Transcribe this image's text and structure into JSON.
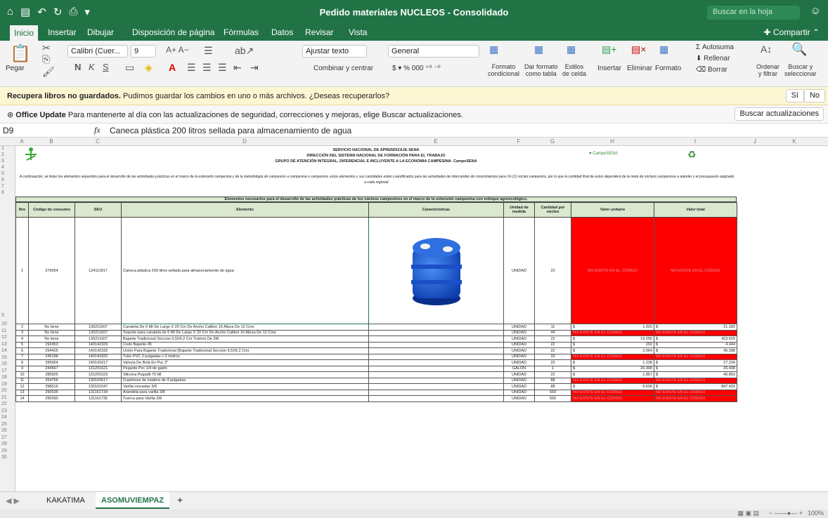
{
  "titlebar": {
    "title": "Pedido materiales NUCLEOS - Consolidado",
    "search_placeholder": "Buscar en la hoja"
  },
  "tabs": [
    "Inicio",
    "Insertar",
    "Dibujar",
    "Disposición de página",
    "Fórmulas",
    "Datos",
    "Revisar",
    "Vista"
  ],
  "share": "Compartir",
  "ribbon": {
    "paste": "Pegar",
    "font_name": "Calibri (Cuer...",
    "font_size": "9",
    "wrap_text": "Ajustar texto",
    "merge_center": "Combinar y centrar",
    "number_format": "General",
    "conditional_format": "Formato\ncondicional",
    "format_table": "Dar formato\ncomo tabla",
    "cell_styles": "Estilos\nde celda",
    "insert": "Insertar",
    "delete": "Eliminar",
    "format": "Formato",
    "autosum": "Autosuma",
    "fill": "Rellenar",
    "clear": "Borrar",
    "sort_filter": "Ordenar\ny filtrar",
    "find_select": "Buscar y\nseleccionar"
  },
  "message_bar": {
    "bold": "Recupera libros no guardados.",
    "text": "Pudimos guardar los cambios en uno o más archivos. ¿Deseas recuperarlos?",
    "yes": "Sí",
    "no": "No"
  },
  "update_bar": {
    "bold": "Office Update",
    "text": "Para mantenerte al día con las actualizaciones de seguridad, correcciones y mejoras, elige Buscar actualizaciones.",
    "button": "Buscar actualizaciones"
  },
  "formula_bar": {
    "name_box": "D9",
    "fx": "fx",
    "value": "Caneca plástica 200 litros sellada para almacenamiento de agua"
  },
  "columns": [
    "A",
    "B",
    "C",
    "D",
    "E",
    "F",
    "G",
    "H",
    "I",
    "J",
    "K"
  ],
  "sheet": {
    "header_lines": [
      "SERVICIO NACIONAL DE APRENDIZAJE-SENA",
      "DIRECCIÓN DEL SISTEMA NACIONAL DE FORMACIÓN PARA EL TRABAJO",
      "GRUPO DE ATENCIÓN INTEGRAL, DIFERENCIAL E INCLUYENTE A LA ECONOMIA CAMPESINA- CampeSENA"
    ],
    "logo_right_text": "CampeSENA",
    "intro": "A continuación, se listan los elementos requeridos para el desarrollo de las actividades prácticas en el marco de la extensión campesina y de la metodología de campesino a campesina o campesino, estos elementos y sus cantidades están cuantificados para las actividades de intercambio de conocimientos para Un (1) núcleo campesino, por lo que la cantidad final de estos dependerá de la meta de núcleos campesinos a atender y el presupuesto asignado a cada regional.",
    "section_title": "Elementos necesarios para el desarrollo de las actividades prácticas de los núcleos campesinos en el marco de la extensión campesina con enfoque agroecológico.",
    "headers": [
      "Nro",
      "Código de consumo",
      "SKU",
      "Elemento",
      "Características",
      "Unidad de medida",
      "Cantidad por núcleo",
      "Valor unitario",
      "Valor total"
    ],
    "no_code_text": "NO EXISTE EN EL CÓDIGO",
    "rows": [
      {
        "n": "1",
        "code": "279054",
        "sku": "124111817",
        "item": "Caneca plástica 200 litros sellada para almacenamiento de agua",
        "unit": "UNIDAD",
        "qty": "22",
        "vu": "",
        "vt": ""
      },
      {
        "n": "2",
        "code": "No tiene",
        "sku": "130211607",
        "item": "Canaleta De 6 Mt De Largo X 20 Cm De Ancho Calibre 16 Altura De 12 Cms",
        "unit": "UNIDAD",
        "qty": "11",
        "vu": "1.926",
        "vt": "21.182"
      },
      {
        "n": "3",
        "code": "No tiene",
        "sku": "130211607",
        "item": "Soporte para canaleta de 6 Mt De Largo X 20 Cm De Ancho Calibre 16 Altura De 12 Cms",
        "unit": "UNIDAD",
        "qty": "44",
        "vu": "",
        "vt": ""
      },
      {
        "n": "4",
        "code": "No tiene",
        "sku": "130211607",
        "item": "Bajante Tradicional Seccion 6,5X6,2 Cm Tramos De 3M",
        "unit": "UNIDAD",
        "qty": "22",
        "vu": "19.255",
        "vt": "423.629"
      },
      {
        "n": "5",
        "code": "292453",
        "sku": "140142329",
        "item": "Codo Bajante 45",
        "unit": "UNIDAD",
        "qty": "22",
        "vu": "202",
        "vt": "4.444"
      },
      {
        "n": "6",
        "code": "294425",
        "sku": "140142332",
        "item": "Unión Para Bajante Tradicional (Bajante Tradicional Seccion 6,5X6,2 Cm)",
        "unit": "UNIDAD",
        "qty": "22",
        "vu": "2.064",
        "vt": "45.398"
      },
      {
        "n": "7",
        "code": "249188",
        "sku": "140141825",
        "item": "Tubo PVC 2 pulgadas x 3 metros",
        "unit": "UNIDAD",
        "qty": "33",
        "vu": "",
        "vt": ""
      },
      {
        "n": "8",
        "code": "295654",
        "sku": "140141617",
        "item": "Valvula De Bola En Pvc 2\"",
        "unit": "UNIDAD",
        "qty": "22",
        "vu": "1.238",
        "vt": "27.234"
      },
      {
        "n": "9",
        "code": "244567",
        "sku": "131201621",
        "item": "Pegante Pvc 1/4 de galón",
        "unit": "GALON",
        "qty": "1",
        "vu": "26.408",
        "vt": "26.408"
      },
      {
        "n": "10",
        "code": "280925",
        "sku": "131201623",
        "item": "Silicona Pegadit 70 Ml",
        "unit": "UNIDAD",
        "qty": "22",
        "vu": "1.857",
        "vt": "40.863"
      },
      {
        "n": "11",
        "code": "254756",
        "sku": "130103617",
        "item": "Cuartones de madera de 4 pulgadas",
        "unit": "UNIDAD",
        "qty": "88",
        "vu": "",
        "vt": ""
      },
      {
        "n": "12",
        "code": "298516",
        "sku": "130101547",
        "item": "Varilla roscadas 3/8",
        "unit": "UNIDAD",
        "qty": "88",
        "vu": "9.630",
        "vt": "847.433"
      },
      {
        "n": "13",
        "code": "290535",
        "sku": "131161734",
        "item": "Arandela para varilla 3/8",
        "unit": "UNIDAD",
        "qty": "550",
        "vu": "",
        "vt": ""
      },
      {
        "n": "14",
        "code": "295390",
        "sku": "131161735",
        "item": "Tuerca para Varilla 3/8",
        "unit": "UNIDAD",
        "qty": "550",
        "vu": "",
        "vt": ""
      }
    ]
  },
  "sheet_tabs": [
    "KAKATIMA",
    "ASOMUVIEMPAZ"
  ],
  "zoom": "100%"
}
